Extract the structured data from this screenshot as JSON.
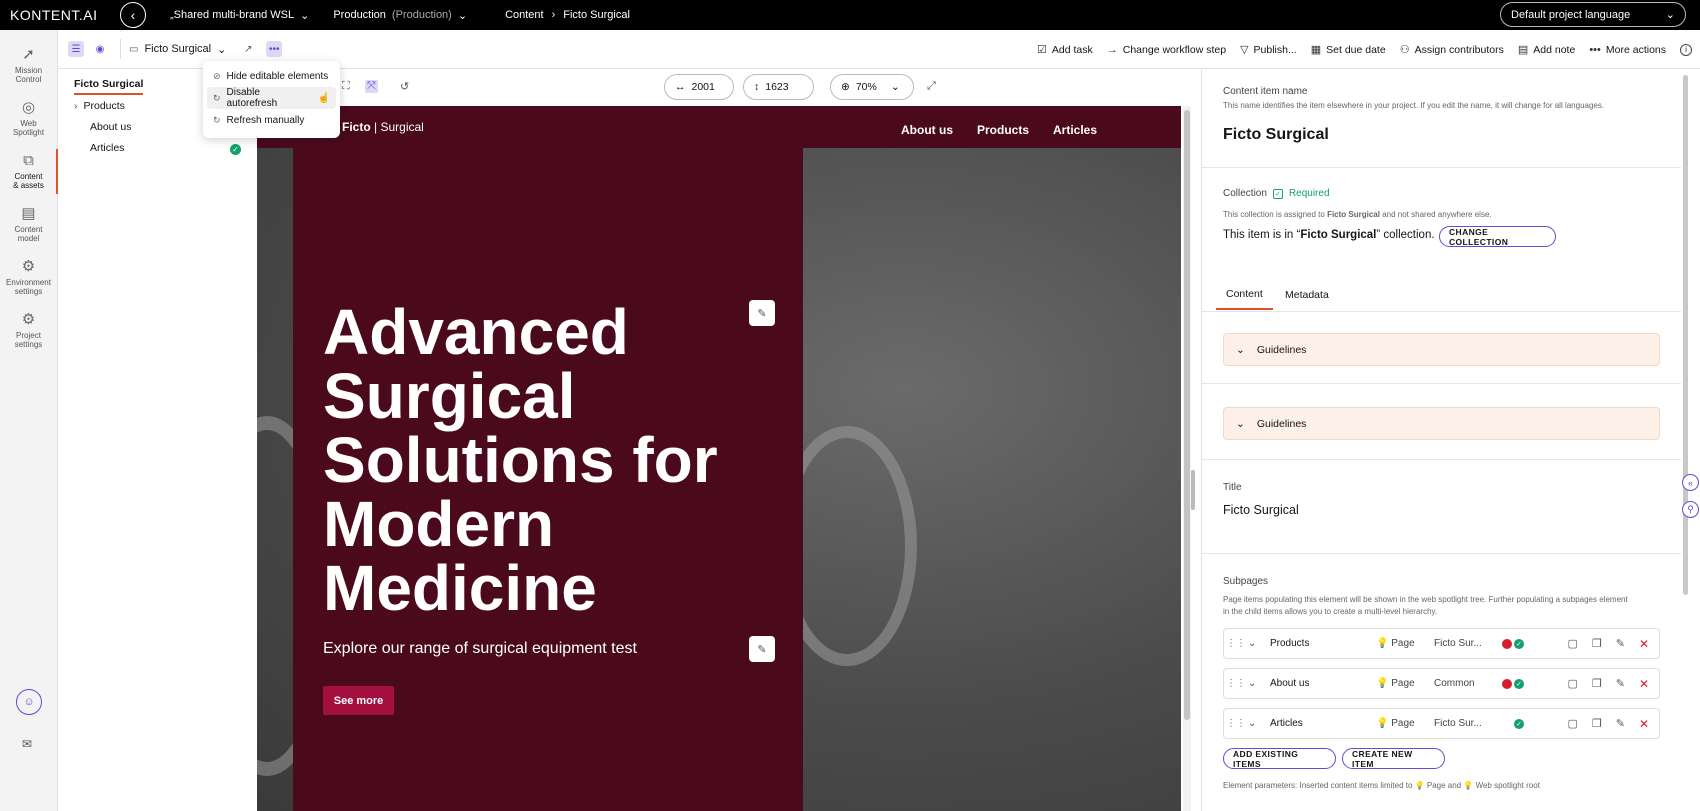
{
  "topbar": {
    "logo": "KONTENT.AI",
    "project": "„Shared multi-brand WSL",
    "environment": "Production",
    "environment_sub": "(Production)",
    "crumb_1": "Content",
    "crumb_2": "Ficto Surgical",
    "language": "Default project language"
  },
  "leftnav": {
    "items": [
      {
        "label_1": "Mission",
        "label_2": "Control",
        "icon": "rocket-icon"
      },
      {
        "label_1": "Web",
        "label_2": "Spotlight",
        "icon": "spotlight-icon"
      },
      {
        "label_1": "Content",
        "label_2": "& assets",
        "icon": "content-icon"
      },
      {
        "label_1": "Content",
        "label_2": "model",
        "icon": "model-icon"
      },
      {
        "label_1": "Environment",
        "label_2": "settings",
        "icon": "gear-icon"
      },
      {
        "label_1": "Project",
        "label_2": "settings",
        "icon": "gear-icon"
      }
    ]
  },
  "toolbar": {
    "item_selector": "Ficto Surgical",
    "actions": {
      "add_task": "Add task",
      "change_workflow": "Change workflow step",
      "publish": "Publish...",
      "due_date": "Set due date",
      "contributors": "Assign contributors",
      "add_note": "Add note",
      "more_actions": "More actions"
    }
  },
  "tree": {
    "root": "Ficto Surgical",
    "items": [
      "Products",
      "About us",
      "Articles"
    ]
  },
  "popup": {
    "items": [
      "Hide editable elements",
      "Disable autorefresh",
      "Refresh manually"
    ]
  },
  "preview_controls": {
    "width": "2001",
    "height": "1623",
    "zoom": "70%"
  },
  "site": {
    "brand_bold": "Ficto",
    "brand_thin": "| Surgical",
    "nav": [
      "About us",
      "Products",
      "Articles"
    ],
    "headline_lines": [
      "Advanced",
      "Surgical",
      "Solutions for",
      "Modern",
      "Medicine"
    ],
    "subheading": "Explore our range of surgical equipment test",
    "cta": "See more"
  },
  "panel": {
    "name_label": "Content item name",
    "name_desc": "This name identifies the item elsewhere in your project. If you edit the name, it will change for all languages.",
    "name_value": "Ficto Surgical",
    "collection_label": "Collection",
    "required": "Required",
    "collection_desc_1": "This collection is assigned to",
    "collection_desc_bold": "Ficto Surgical",
    "collection_desc_2": "and not shared anywhere else.",
    "collection_line_1": "This item is in “",
    "collection_line_bold": "Ficto Surgical",
    "collection_line_2": "” collection.",
    "change_collection": "CHANGE COLLECTION",
    "tabs": [
      "Content",
      "Metadata"
    ],
    "guidelines": "Guidelines",
    "title_label": "Title",
    "title_value": "Ficto Surgical",
    "subpages_label": "Subpages",
    "subpages_desc_1": "Page items populating this element will be shown in the web spotlight tree. Further populating a subpages element",
    "subpages_desc_2": "in the child items allows you to create a multi-level hierarchy.",
    "subpages": [
      {
        "name": "Products",
        "type": "Page",
        "collection": "Ficto Sur..."
      },
      {
        "name": "About us",
        "type": "Page",
        "collection": "Common"
      },
      {
        "name": "Articles",
        "type": "Page",
        "collection": "Ficto Sur..."
      }
    ],
    "add_existing": "ADD EXISTING ITEMS",
    "create_new": "CREATE NEW ITEM",
    "params_1": "Element parameters: Inserted content items limited to",
    "params_page": "Page",
    "params_and": "and",
    "params_root": "Web spotlight root"
  },
  "colors": {
    "accent": "#5b4fd6",
    "hero": "#4a0a1c",
    "cta": "#a3103f",
    "active_underline": "#e0522a"
  }
}
